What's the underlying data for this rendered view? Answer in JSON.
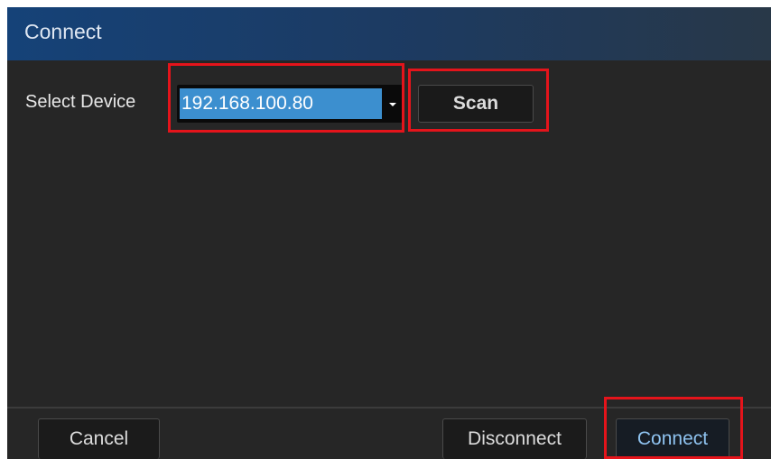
{
  "dialog": {
    "title": "Connect"
  },
  "form": {
    "select_device_label": "Select Device",
    "device_select": {
      "selected_value": "192.168.100.80"
    },
    "scan_label": "Scan"
  },
  "footer": {
    "cancel_label": "Cancel",
    "disconnect_label": "Disconnect",
    "connect_label": "Connect"
  },
  "colors": {
    "titlebar": "#154278",
    "dialog_background": "#262626",
    "selection": "#3c8fcf",
    "highlight": "#e4141b",
    "connect_text": "#8fc3f0"
  }
}
